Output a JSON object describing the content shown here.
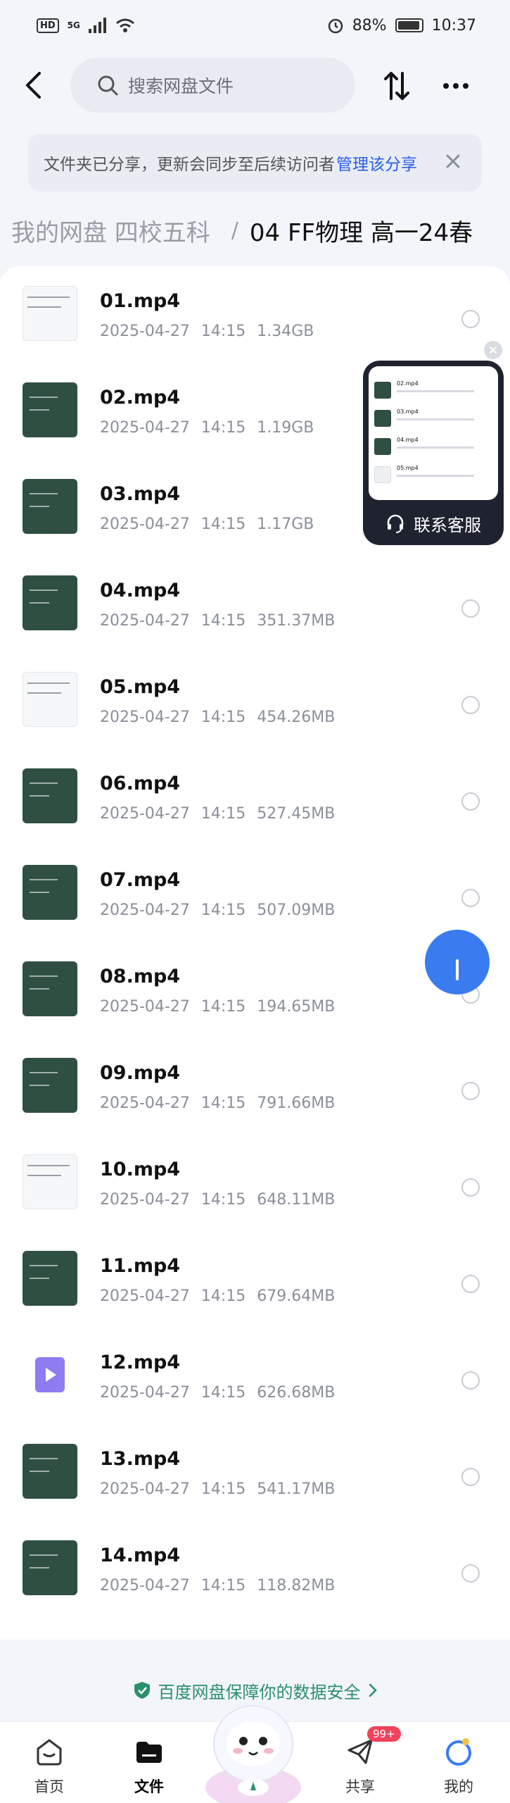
{
  "status_bar": {
    "left_badges": [
      "HD",
      "5G"
    ],
    "battery": "88%",
    "time": "10:37"
  },
  "search": {
    "placeholder": "搜索网盘文件"
  },
  "notice": {
    "text": "文件夹已分享，更新会同步至后续访问者",
    "link": "管理该分享"
  },
  "breadcrumb": {
    "previous": "我的网盘  四校五科",
    "separator": "/",
    "current": "04 FF物理 高一24春"
  },
  "files": [
    {
      "name": "01.mp4",
      "date": "2025-04-27",
      "time": "14:15",
      "size": "1.34GB",
      "thumb": "paper"
    },
    {
      "name": "02.mp4",
      "date": "2025-04-27",
      "time": "14:15",
      "size": "1.19GB",
      "thumb": "board"
    },
    {
      "name": "03.mp4",
      "date": "2025-04-27",
      "time": "14:15",
      "size": "1.17GB",
      "thumb": "board"
    },
    {
      "name": "04.mp4",
      "date": "2025-04-27",
      "time": "14:15",
      "size": "351.37MB",
      "thumb": "board"
    },
    {
      "name": "05.mp4",
      "date": "2025-04-27",
      "time": "14:15",
      "size": "454.26MB",
      "thumb": "paper"
    },
    {
      "name": "06.mp4",
      "date": "2025-04-27",
      "time": "14:15",
      "size": "527.45MB",
      "thumb": "board"
    },
    {
      "name": "07.mp4",
      "date": "2025-04-27",
      "time": "14:15",
      "size": "507.09MB",
      "thumb": "board"
    },
    {
      "name": "08.mp4",
      "date": "2025-04-27",
      "time": "14:15",
      "size": "194.65MB",
      "thumb": "board"
    },
    {
      "name": "09.mp4",
      "date": "2025-04-27",
      "time": "14:15",
      "size": "791.66MB",
      "thumb": "board"
    },
    {
      "name": "10.mp4",
      "date": "2025-04-27",
      "time": "14:15",
      "size": "648.11MB",
      "thumb": "paper"
    },
    {
      "name": "11.mp4",
      "date": "2025-04-27",
      "time": "14:15",
      "size": "679.64MB",
      "thumb": "board"
    },
    {
      "name": "12.mp4",
      "date": "2025-04-27",
      "time": "14:15",
      "size": "626.68MB",
      "thumb": "video"
    },
    {
      "name": "13.mp4",
      "date": "2025-04-27",
      "time": "14:15",
      "size": "541.17MB",
      "thumb": "board"
    },
    {
      "name": "14.mp4",
      "date": "2025-04-27",
      "time": "14:15",
      "size": "118.82MB",
      "thumb": "board"
    }
  ],
  "cs_widget": {
    "label": "联系客服",
    "preview_rows": [
      "02.mp4",
      "03.mp4",
      "04.mp4",
      "05.mp4"
    ]
  },
  "security": {
    "text": "百度网盘保障你的数据安全"
  },
  "bottom_nav": {
    "items": [
      {
        "label": "首页",
        "icon": "home-icon"
      },
      {
        "label": "文件",
        "icon": "folder-icon"
      },
      {
        "label": "共享",
        "icon": "share-icon",
        "badge": "99+"
      },
      {
        "label": "我的",
        "icon": "profile-icon"
      }
    ]
  },
  "colors": {
    "accent": "#2a5ee8",
    "security_green": "#2b8f6e",
    "badge_red": "#f0445d",
    "widget_dark": "#1f2330"
  }
}
